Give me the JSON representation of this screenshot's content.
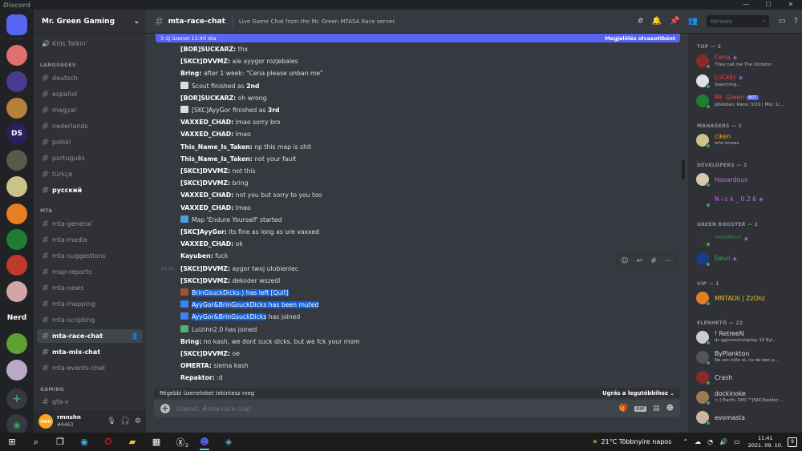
{
  "window": {
    "title": "Discord",
    "min": "—",
    "max": "☐",
    "close": "✕"
  },
  "guilds": [
    {
      "label": "",
      "color": "#5865f2",
      "icon": "discord-home-icon",
      "badge": ""
    },
    {
      "label": "",
      "color": "#e06f6f",
      "icon": "server-icon",
      "badge": "4"
    },
    {
      "label": "",
      "color": "#4a3a8f",
      "icon": "server-icon",
      "badge": "1"
    },
    {
      "label": "",
      "color": "#b5813a",
      "icon": "server-icon",
      "badge": "10"
    },
    {
      "label": "DS",
      "color": "#2d1e5e",
      "icon": "server-icon",
      "badge": "70"
    },
    {
      "label": "",
      "color": "#555a4a",
      "icon": "server-icon",
      "badge": ""
    },
    {
      "label": "",
      "color": "#c9c38a",
      "icon": "server-icon",
      "badge": "1"
    },
    {
      "label": "",
      "color": "#e67e22",
      "icon": "server-icon",
      "badge": "53"
    },
    {
      "label": "",
      "color": "#1e7d32",
      "icon": "server-icon",
      "badge": ""
    },
    {
      "label": "",
      "color": "#c0392b",
      "icon": "server-icon",
      "badge": "132"
    },
    {
      "label": "",
      "color": "#d4a5a5",
      "icon": "server-icon",
      "badge": "1"
    },
    {
      "label": "Nerd",
      "color": "#222222",
      "icon": "server-icon",
      "badge": "11"
    },
    {
      "label": "",
      "color": "#5da130",
      "icon": "server-icon",
      "badge": "1"
    },
    {
      "label": "",
      "color": "#b8a9c9",
      "icon": "server-icon",
      "badge": ""
    }
  ],
  "server": {
    "name": "Mr. Green Gaming"
  },
  "channels": {
    "top": [
      {
        "name": "Kids Talkin'",
        "type": "voice"
      }
    ],
    "languages_label": "LANGUAGES",
    "languages": [
      "deutsch",
      "español",
      "magyar",
      "nederlands",
      "polski",
      "português",
      "türkçe",
      "русский"
    ],
    "mta_label": "MTA",
    "mta": [
      "mta-general",
      "mta-media",
      "mta-suggestions",
      "map-reports",
      "mta-news",
      "mta-mapping",
      "mta-scripting",
      "mta-race-chat",
      "mta-mix-chat",
      "mta-events-chat"
    ],
    "gaming_label": "GAMING",
    "gaming": [
      "gta-v"
    ]
  },
  "user": {
    "name": "rmnshn",
    "tag": "#6463",
    "avatar": "rmn"
  },
  "header": {
    "channel": "mta-race-chat",
    "topic": "Live Game Chat from the Mr. Green MTASA Race server.",
    "search_placeholder": "Keresés"
  },
  "newbar": {
    "text": "3 új üzenet 11:40 óta",
    "action": "Megjelölés olvasottként"
  },
  "messages": [
    {
      "author": "[BOR]SUCKARZ:",
      "text": " thx"
    },
    {
      "author": "[SKCt]DVVMZ:",
      "text": " ale ayygor rozjebales"
    },
    {
      "author": "Bring:",
      "text": " after 1 week: \"Cena please unban me\""
    },
    {
      "sys": "finish",
      "text": "Scout finished as ",
      "bold": "2nd"
    },
    {
      "author": "[BOR]SUCKARZ:",
      "text": " oh wrong"
    },
    {
      "sys": "finish",
      "text": "[SKC]AyyGor finished as ",
      "bold": "3rd"
    },
    {
      "author": "VAXXED_CHAD:",
      "text": " lmao sorry bro"
    },
    {
      "author": "VAXXED_CHAD:",
      "text": " lmao"
    },
    {
      "author": "This_Name_Is_Taken:",
      "text": " np this map is shit"
    },
    {
      "author": "This_Name_Is_Taken:",
      "text": " not your fault"
    },
    {
      "author": "[SKCt]DVVMZ:",
      "text": " not this"
    },
    {
      "author": "[SKCt]DVVMZ:",
      "text": " bring"
    },
    {
      "author": "VAXXED_CHAD:",
      "text": " not you but sorry to you too"
    },
    {
      "author": "VAXXED_CHAD:",
      "text": " lmao"
    },
    {
      "sys": "map",
      "text": "Map 'Endure Yourself' started"
    },
    {
      "author": "[SKC]AyyGor:",
      "text": " its fine as long as ure vaxxed"
    },
    {
      "author": "VAXXED_CHAD:",
      "text": " ok"
    },
    {
      "author": "Kayuben:",
      "text": " fuck"
    },
    {
      "author": "[SKCt]DVVMZ:",
      "text": " aygor twoj ulubieniec",
      "time": "13:20"
    },
    {
      "author": "[SKCt]DVVMZ:",
      "text": " dekoder wszedl"
    },
    {
      "sys": "quit",
      "text": "BrinGsuckDicks:) has left [Quit]",
      "hl": true
    },
    {
      "sys": "mute",
      "text": "AyyGor&BrinGsuckDicks has been muted",
      "hl": true
    },
    {
      "sys": "join",
      "text": "AyyGor&BrinGsuckDicks",
      "tail": " has joined",
      "hl": true
    },
    {
      "sys": "join2",
      "text": "Luizinn2.0 has joined"
    },
    {
      "author": "Bring:",
      "text": " no kash, we dont suck dicks, but we fck your mom"
    },
    {
      "author": "[SKCt]DVVMZ:",
      "text": " oe"
    },
    {
      "author": "OMERTA:",
      "text": " siema kash"
    },
    {
      "author": "Repaktor:",
      "text": " :d"
    }
  ],
  "older": {
    "text": "Régebbi üzeneteket tekintesz meg",
    "action": "Ugrás a legutóbbihoz"
  },
  "composer": {
    "placeholder": "Üzenet: #mta-race-chat",
    "gif": "GIF"
  },
  "members": {
    "groups": [
      {
        "label": "TOP — 3",
        "items": [
          {
            "name": "Cena",
            "sub": "They call me The Dictator",
            "color": "#ed4245",
            "av": "#8a2b2b",
            "gem": true
          },
          {
            "name": "LuCkEr",
            "sub": "Searching...",
            "color": "#ed4245",
            "av": "#e0e0e0",
            "gem": true
          },
          {
            "name": "Mr. Green",
            "sub": "Játékban: Race: 3/20 | Mix: 1/...",
            "color": "#ed4245",
            "av": "#1e7d32",
            "bot": "BOT"
          }
        ]
      },
      {
        "label": "MANAGERS — 1",
        "items": [
          {
            "name": "ciken",
            "sub": "who knows",
            "color": "#faa61a",
            "av": "#c9c38a"
          }
        ]
      },
      {
        "label": "DEVELOPERS — 2",
        "items": [
          {
            "name": "Haxardous",
            "sub": "",
            "color": "#c86cf2",
            "av": "#d4c9a8"
          },
          {
            "name": "N i c k _ 0 2 6",
            "sub": "",
            "color": "#c86cf2",
            "av": "#2f3136",
            "gem": true
          }
        ]
      },
      {
        "label": "GREEN BOOSTER — 2",
        "items": [
          {
            "name": "ᴳᴿᴱᴱᴺᴮᴼᴼˢᵀ",
            "sub": "",
            "color": "#3ba55d",
            "av": "#333333",
            "gem": true
          },
          {
            "name": "Devil",
            "sub": "",
            "color": "#3ba55d",
            "av": "#1a3a8a",
            "gem": true
          }
        ]
      },
      {
        "label": "VIP — 1",
        "items": [
          {
            "name": "MNTAOli | ZzOliz",
            "sub": "",
            "color": "#f1c40f",
            "av": "#e67e22"
          }
        ]
      },
      {
        "label": "ELÉRHETŐ — 22",
        "items": [
          {
            "name": "! RetreeN",
            "sub": "dc.gg/umutroleplay 10 Eyl...",
            "color": "#dcddde",
            "av": "#cccccc"
          },
          {
            "name": "ByPlankton",
            "sub": "Ne sen kille ol, ne de ben p...",
            "color": "#dcddde",
            "av": "#555555"
          },
          {
            "name": "Crash",
            "sub": "",
            "color": "#dcddde",
            "av": "#8a2b2b"
          },
          {
            "name": "dockinoke",
            "sub": "> [:Earth: DM] \"\"[SKC]bolder:...",
            "color": "#dcddde",
            "av": "#a07a50"
          },
          {
            "name": "evomasta",
            "sub": "",
            "color": "#dcddde",
            "av": "#c9b9a0"
          }
        ]
      }
    ]
  },
  "taskbar": {
    "weather": "21°C  Többnyire napos",
    "time": "11:41",
    "date": "2021. 09. 10.",
    "notifications": "9",
    "xbox_badge": "2"
  }
}
